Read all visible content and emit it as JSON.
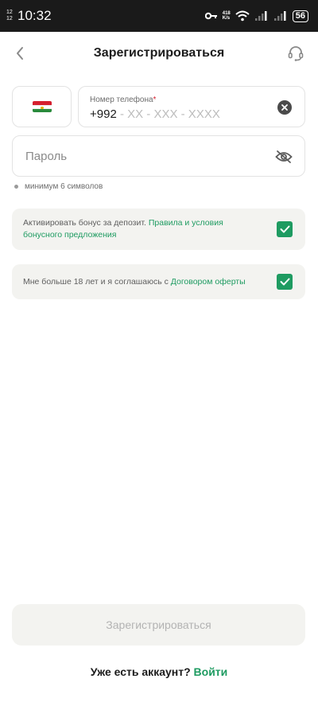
{
  "status_bar": {
    "small_top": "12",
    "small_bottom": "12",
    "time": "10:32",
    "net_speed_top": "418",
    "net_speed_bottom": "K/s",
    "battery": "56",
    "icons": [
      "vpn-key-icon",
      "wifi-icon",
      "signal-icon",
      "signal-icon",
      "battery-icon"
    ]
  },
  "header": {
    "title": "Зарегистрироваться",
    "back_icon": "chevron-left-icon",
    "support_icon": "headset-icon"
  },
  "phone": {
    "country_flag": "tajikistan-flag-icon",
    "label": "Номер телефона",
    "required_mark": "*",
    "prefix": "+992",
    "mask": " - XX - XXX - XXXX",
    "clear_icon": "clear-icon"
  },
  "password": {
    "placeholder": "Пароль",
    "visibility_icon": "eye-off-icon",
    "hint": "минимум 6 символов"
  },
  "bonus": {
    "text": "Активировать бонус за депозит.",
    "link": "Правила и условия бонусного предложения",
    "checked": true
  },
  "age": {
    "text": "Мне больше 18 лет и я соглашаюсь с",
    "link": "Договором оферты",
    "checked": true
  },
  "submit": {
    "label": "Зарегистрироваться",
    "enabled": false
  },
  "login": {
    "question": "Уже есть аккаунт?",
    "link": "Войти"
  },
  "colors": {
    "accent": "#1e9b61",
    "card_bg": "#f3f3f0",
    "required": "#d51f2e"
  }
}
